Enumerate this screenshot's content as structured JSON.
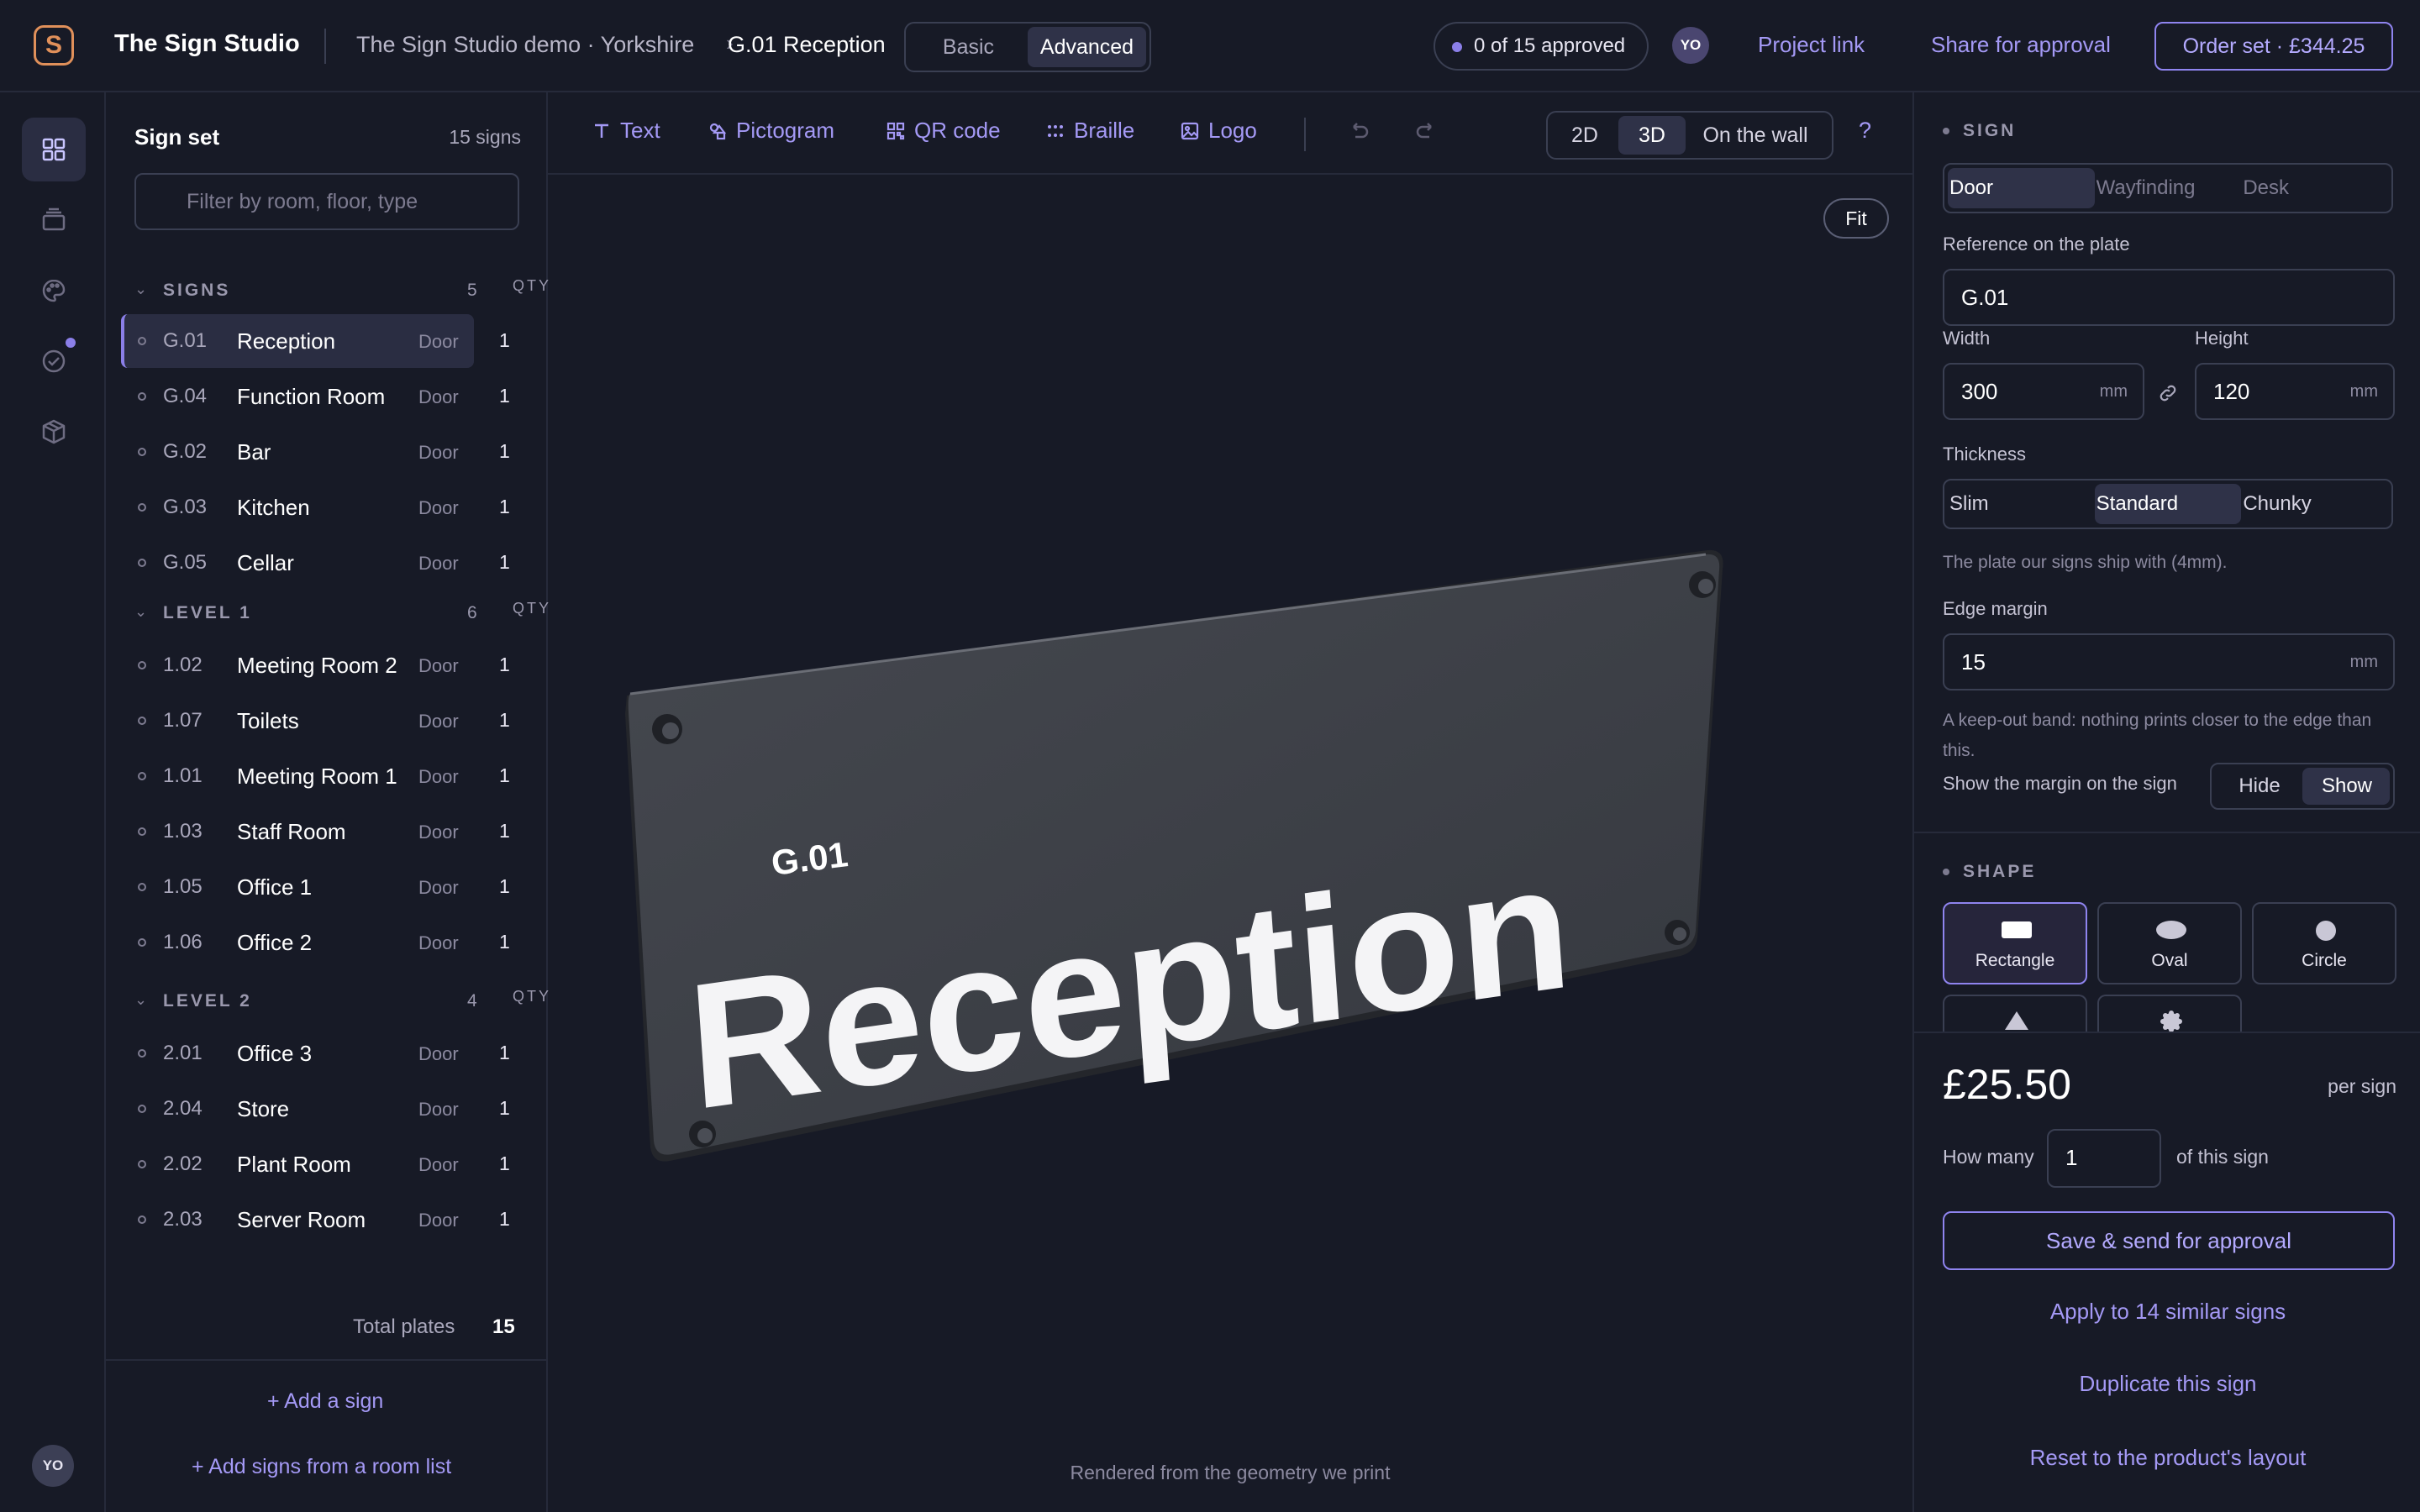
{
  "header": {
    "brand": "The Sign Studio",
    "breadcrumb_project": "The Sign Studio demo · Yorkshire",
    "breadcrumb_separator": "›",
    "breadcrumb_sign": "G.01 Reception",
    "mode_tabs": [
      "Basic",
      "Advanced"
    ],
    "mode_selected": "Advanced",
    "approval_status": "0 of 15 approved",
    "avatar_initials": "YO",
    "project_link": "Project link",
    "share_link": "Share for approval",
    "order_button": "Order set · £344.25"
  },
  "rail": {
    "icons": [
      "grid-icon",
      "layers-icon",
      "palette-icon",
      "check-circle-icon",
      "package-icon"
    ],
    "avatar_initials": "YO"
  },
  "sidebar": {
    "title": "Sign set",
    "count": "15 signs",
    "filter_placeholder": "Filter by room, floor, type",
    "qty_header": "QTY",
    "groups": [
      {
        "name": "SIGNS",
        "count": "5",
        "rows": [
          {
            "ref": "G.01",
            "name": "Reception",
            "type": "Door",
            "qty": "1",
            "selected": true
          },
          {
            "ref": "G.04",
            "name": "Function Room",
            "type": "Door",
            "qty": "1"
          },
          {
            "ref": "G.02",
            "name": "Bar",
            "type": "Door",
            "qty": "1"
          },
          {
            "ref": "G.03",
            "name": "Kitchen",
            "type": "Door",
            "qty": "1"
          },
          {
            "ref": "G.05",
            "name": "Cellar",
            "type": "Door",
            "qty": "1"
          }
        ]
      },
      {
        "name": "LEVEL 1",
        "count": "6",
        "rows": [
          {
            "ref": "1.02",
            "name": "Meeting Room 2",
            "type": "Door",
            "qty": "1"
          },
          {
            "ref": "1.07",
            "name": "Toilets",
            "type": "Door",
            "qty": "1"
          },
          {
            "ref": "1.01",
            "name": "Meeting Room 1",
            "type": "Door",
            "qty": "1"
          },
          {
            "ref": "1.03",
            "name": "Staff Room",
            "type": "Door",
            "qty": "1"
          },
          {
            "ref": "1.05",
            "name": "Office 1",
            "type": "Door",
            "qty": "1"
          },
          {
            "ref": "1.06",
            "name": "Office 2",
            "type": "Door",
            "qty": "1"
          }
        ]
      },
      {
        "name": "LEVEL 2",
        "count": "4",
        "rows": [
          {
            "ref": "2.01",
            "name": "Office 3",
            "type": "Door",
            "qty": "1"
          },
          {
            "ref": "2.04",
            "name": "Store",
            "type": "Door",
            "qty": "1"
          },
          {
            "ref": "2.02",
            "name": "Plant Room",
            "type": "Door",
            "qty": "1"
          },
          {
            "ref": "2.03",
            "name": "Server Room",
            "type": "Door",
            "qty": "1"
          }
        ]
      }
    ],
    "total_label": "Total plates",
    "total_value": "15",
    "add_sign": "+ Add a sign",
    "add_from_list": "+ Add signs from a room list"
  },
  "canvas": {
    "tools": [
      {
        "label": "Text",
        "icon": "text-icon"
      },
      {
        "label": "Pictogram",
        "icon": "pictogram-icon"
      },
      {
        "label": "QR code",
        "icon": "qr-code-icon"
      },
      {
        "label": "Braille",
        "icon": "braille-icon"
      },
      {
        "label": "Logo",
        "icon": "image-icon"
      }
    ],
    "view_tabs": [
      "2D",
      "3D",
      "On the wall"
    ],
    "view_selected": "3D",
    "help": "?",
    "fit": "Fit",
    "sign_ref": "G.01",
    "sign_name": "Reception",
    "caption": "Rendered from the geometry we print"
  },
  "panel": {
    "sign_header": "SIGN",
    "sign_types": [
      "Door",
      "Wayfinding",
      "Desk"
    ],
    "sign_type_selected": "Door",
    "reference_label": "Reference on the plate",
    "reference_value": "G.01",
    "width_label": "Width",
    "width_value": "300",
    "height_label": "Height",
    "height_value": "120",
    "unit": "mm",
    "thickness_label": "Thickness",
    "thickness_options": [
      "Slim",
      "Standard",
      "Chunky"
    ],
    "thickness_selected": "Standard",
    "thickness_hint": "The plate our signs ship with (4mm).",
    "edge_margin_label": "Edge margin",
    "edge_margin_value": "15",
    "edge_margin_hint": "A keep-out band: nothing prints closer to the edge than this.",
    "show_margin_label": "Show the margin on the sign",
    "show_margin_options": [
      "Hide",
      "Show"
    ],
    "show_margin_selected": "Show",
    "shape_header": "SHAPE",
    "shapes": [
      "Rectangle",
      "Oval",
      "Circle"
    ],
    "shape_selected": "Rectangle",
    "price": "£25.50",
    "per_sign": "per sign",
    "how_many_label": "How many",
    "how_many_value": "1",
    "of_this_sign": "of this sign",
    "save_button": "Save & send for approval",
    "apply_similar": "Apply to 14 similar signs",
    "duplicate": "Duplicate this sign",
    "reset": "Reset to the product's layout"
  },
  "colors": {
    "background": "#171a26",
    "accent": "#8f84ef",
    "brand_logo": "#e0905a",
    "plate": "#3a3d45"
  }
}
